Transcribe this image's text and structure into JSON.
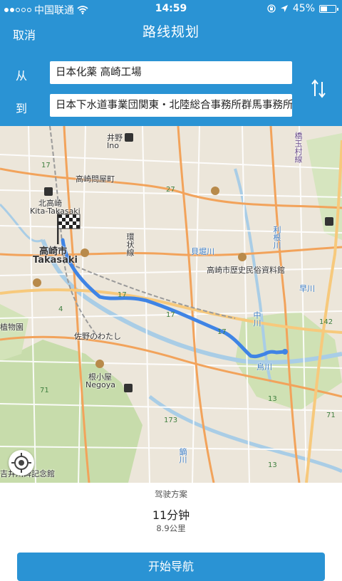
{
  "status_bar": {
    "carrier": "中国联通",
    "time": "14:59",
    "battery_percent": "45%",
    "battery_level": 0.45,
    "icons": [
      "signal-dots",
      "wifi-icon",
      "rotation-lock-icon",
      "location-arrow-icon",
      "battery-icon"
    ]
  },
  "nav": {
    "cancel_label": "取消",
    "title": "路线规划"
  },
  "route": {
    "from_label": "从",
    "from_value": "日本化薬 高崎工場",
    "to_label": "到",
    "to_value": "日本下水道事業団関東・北陸総合事務所群馬事務所",
    "swap_icon": "swap-vertical-icon"
  },
  "map": {
    "labels": {
      "ino_jp": "井野",
      "ino_en": "Ino",
      "takasaki_tonyamachi": "高崎問屋町",
      "kita_takasaki_jp": "北高崎",
      "kita_takasaki_en": "Kita-Takasaki",
      "takasaki_jp": "高崎市",
      "takasaki_en": "Takasaki",
      "kanjo_line": "環状線",
      "kaiborigawa": "貝堀川",
      "museum": "高崎市歴史民俗資料館",
      "botanical": "植物園",
      "sanoowatashi": "佐野のわたし",
      "negoya_jp": "根小屋",
      "negoya_en": "Negoya",
      "karasugawa": "烏川",
      "hayakawa": "早川",
      "yoshiigawa": "吉井川碑記念館",
      "kaburagawa": "鏑川",
      "tonegawa": "利根川",
      "naka_river": "中川",
      "right_top_label": "橋玉村線"
    },
    "route_numbers": [
      "17",
      "27",
      "17",
      "17",
      "17",
      "142",
      "13",
      "173",
      "71",
      "71",
      "13",
      "4"
    ],
    "locate_icon": "crosshair-location-icon",
    "destination_flag_icon": "checkered-flag-icon",
    "route_color": "#3f84e5"
  },
  "summary": {
    "plan_title": "驾驶方案",
    "duration": "11分钟",
    "distance": "8.9公里",
    "start_button": "开始导航"
  },
  "colors": {
    "accent": "#2a93d4",
    "map_bg": "#ece6da",
    "park": "#c5dba8",
    "road_major": "#f2a35b",
    "road_highway": "#f7c97c",
    "river": "#a9cde6"
  }
}
